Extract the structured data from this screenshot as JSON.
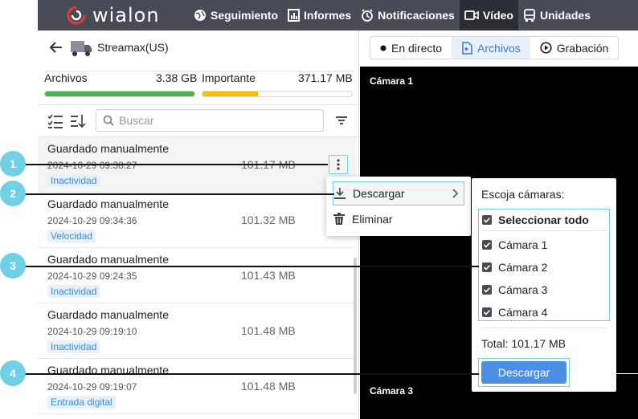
{
  "topbar": {
    "logo_text": "wialon",
    "nav": [
      {
        "label": "Seguimiento",
        "icon": "globe-icon"
      },
      {
        "label": "Informes",
        "icon": "report-icon"
      },
      {
        "label": "Notificaciones",
        "icon": "alarm-icon"
      },
      {
        "label": "Vídeo",
        "icon": "video-icon",
        "active": true
      },
      {
        "label": "Unidades",
        "icon": "bus-icon"
      }
    ]
  },
  "unit": {
    "name": "Streamax(US)"
  },
  "storage": {
    "files_label": "Archivos",
    "files_value": "3.38 GB",
    "files_fill_percent": 100,
    "important_label": "Importante",
    "important_value": "371.17 MB",
    "important_fill_percent": 37
  },
  "search": {
    "placeholder": "Buscar"
  },
  "files": [
    {
      "title": "Guardado manualmente",
      "date": "2024-10-29 09:38:27",
      "size": "101.17 MB",
      "tag": "Inactividad",
      "selected": true
    },
    {
      "title": "Guardado manualmente",
      "date": "2024-10-29 09:34:36",
      "size": "101.32 MB",
      "tag": "Velocidad"
    },
    {
      "title": "Guardado manualmente",
      "date": "2024-10-29 09:24:35",
      "size": "101.43 MB",
      "tag": "Inactividad"
    },
    {
      "title": "Guardado manualmente",
      "date": "2024-10-29 09:19:10",
      "size": "101.48 MB",
      "tag": "Inactividad"
    },
    {
      "title": "Guardado manualmente",
      "date": "2024-10-29 09:19:07",
      "size": "101.48 MB",
      "tag": "Entrada digital"
    }
  ],
  "video_tabs": [
    {
      "label": "En directo",
      "icon": "dot-icon"
    },
    {
      "label": "Archivos",
      "icon": "archive-icon",
      "active": true
    },
    {
      "label": "Grabación",
      "icon": "record-icon"
    }
  ],
  "cameras_view": {
    "cam1": "Cámara 1",
    "cam3": "Cámara 3"
  },
  "menu": {
    "download": "Descargar",
    "delete": "Eliminar"
  },
  "chooser": {
    "title": "Escoja cámaras:",
    "select_all": "Seleccionar todo",
    "cameras": [
      "Cámara 1",
      "Cámara 2",
      "Cámara 3",
      "Cámara 4"
    ],
    "total": "Total: 101.17 MB",
    "download_button": "Descargar"
  },
  "callouts": [
    "1",
    "2",
    "3",
    "4"
  ],
  "colors": {
    "accent": "#4a8fe3",
    "callout": "#6fd0e6",
    "topbar": "#474b55",
    "green": "#4caf50",
    "yellow": "#f5c000"
  }
}
